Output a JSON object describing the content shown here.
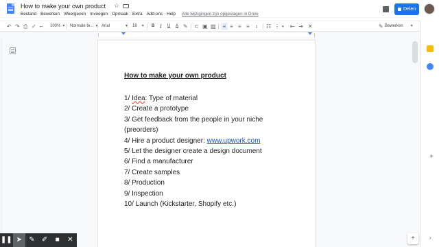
{
  "doc": {
    "title": "How to make your own product",
    "star_icon": "star-icon",
    "folder_icon": "folder-icon"
  },
  "menu": [
    "Bestand",
    "Bewerken",
    "Weergeven",
    "Invoegen",
    "Opmaak",
    "Extra",
    "Add-ons",
    "Help"
  ],
  "saved_status": "Alle wijzigingen zijn opgeslagen in Drive",
  "share": {
    "label": "Delen",
    "color": "#1a73e8"
  },
  "toolbar": {
    "zoom": "100%",
    "style": "Normale te...",
    "font": "Arial",
    "size": "18",
    "bold": "B",
    "italic": "I",
    "underline": "U",
    "text_color": "A",
    "mode": "Bewerken"
  },
  "body": {
    "heading": "How to make your own product",
    "lines": [
      {
        "prefix": "1/ ",
        "misspelled": "Idea",
        "text": ": Type of material"
      },
      {
        "text": "2/ Create a prototype"
      },
      {
        "text": "3/ Get feedback from the people in your niche"
      },
      {
        "text": "(preorders)"
      },
      {
        "text": "4/ Hire a product designer: ",
        "link": "www.upwork.com"
      },
      {
        "text": "5/ Let the designer create a design document"
      },
      {
        "text": "6/ Find a manufacturer"
      },
      {
        "text": "7/ Create samples"
      },
      {
        "text": "8/ Production"
      },
      {
        "text": "9/ Inspection"
      },
      {
        "text": "10/ Launch (Kickstarter, Shopify etc.)"
      }
    ]
  },
  "overlay_tools": [
    "pause-icon",
    "pointer-icon",
    "pen-icon",
    "highlighter-icon",
    "camera-icon",
    "close-icon"
  ],
  "colors": {
    "accent": "#1a73e8",
    "link": "#1155cc",
    "misspell": "#d93025"
  }
}
